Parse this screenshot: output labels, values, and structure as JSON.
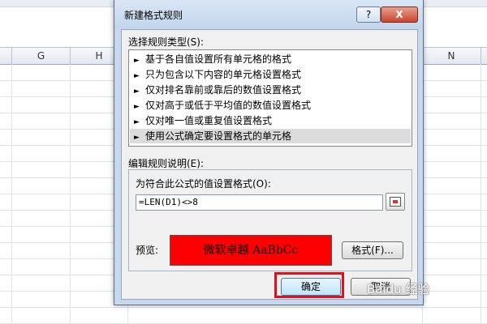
{
  "spreadsheet": {
    "columns": [
      "G",
      "H",
      "N"
    ]
  },
  "dialog": {
    "title": "新建格式规则",
    "help_label": "?",
    "close_label": "X",
    "rule_type_label": "选择规则类型(S):",
    "rule_types": [
      {
        "label": "基于各自值设置所有单元格的格式",
        "selected": false
      },
      {
        "label": "只为包含以下内容的单元格设置格式",
        "selected": false
      },
      {
        "label": "仅对排名靠前或靠后的数值设置格式",
        "selected": false
      },
      {
        "label": "仅对高于或低于平均值的数值设置格式",
        "selected": false
      },
      {
        "label": "仅对唯一值或重复值设置格式",
        "selected": false
      },
      {
        "label": "使用公式确定要设置格式的单元格",
        "selected": true
      }
    ],
    "edit_rule_label": "编辑规则说明(E):",
    "formula_label": "为符合此公式的值设置格式(O):",
    "formula_value": "=LEN(D1)<>8",
    "preview_label": "预览:",
    "preview_text": "微软卓越  AaBbCc",
    "preview_color": "#ff0000",
    "format_button": "格式(F)...",
    "ok_button": "确定",
    "cancel_button": "取消",
    "highlight_color": "#e0101e"
  },
  "watermark": "Baidu 经验"
}
